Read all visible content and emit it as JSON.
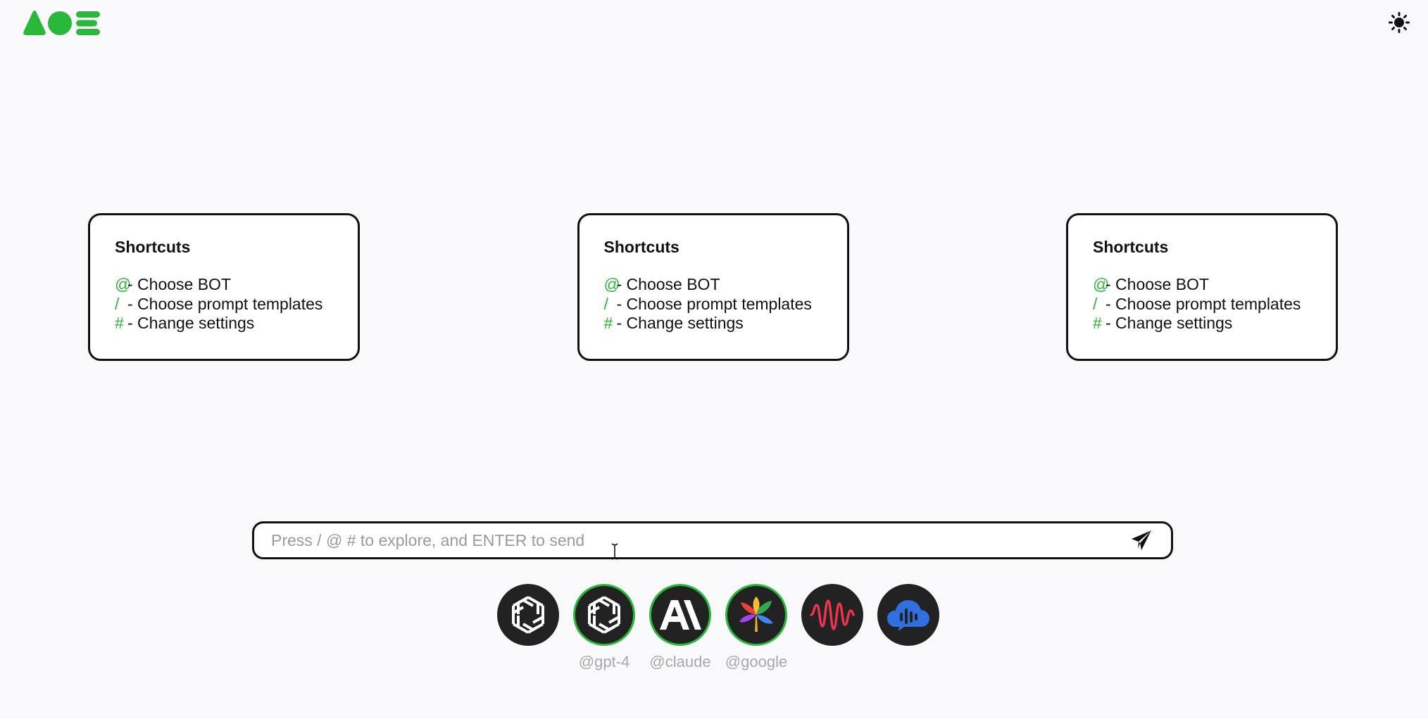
{
  "brand": {
    "logo_icon": "aoe-logo-icon",
    "accent": "#2ab83a"
  },
  "header": {
    "theme_icon": "sun-icon"
  },
  "cards": [
    {
      "title": "Shortcuts",
      "lines": [
        {
          "key": "@",
          "text": "- Choose BOT"
        },
        {
          "key": "/",
          "text": "- Choose prompt templates"
        },
        {
          "key": "#",
          "text": "- Change settings"
        }
      ]
    },
    {
      "title": "Shortcuts",
      "lines": [
        {
          "key": "@",
          "text": "- Choose BOT"
        },
        {
          "key": "/",
          "text": "- Choose prompt templates"
        },
        {
          "key": "#",
          "text": "- Change settings"
        }
      ]
    },
    {
      "title": "Shortcuts",
      "lines": [
        {
          "key": "@",
          "text": "- Choose BOT"
        },
        {
          "key": "/",
          "text": "- Choose prompt templates"
        },
        {
          "key": "#",
          "text": "- Change settings"
        }
      ]
    }
  ],
  "composer": {
    "placeholder": "Press / @ # to explore, and ENTER to send",
    "value": "",
    "send_icon": "send-icon"
  },
  "bots": [
    {
      "icon": "openai-icon",
      "label": "",
      "selected": false
    },
    {
      "icon": "openai-icon",
      "label": "@gpt-4",
      "selected": true
    },
    {
      "icon": "anthropic-icon",
      "label": "@claude",
      "selected": true
    },
    {
      "icon": "google-bard-icon",
      "label": "@google",
      "selected": true
    },
    {
      "icon": "soundwave-icon",
      "label": "",
      "selected": false
    },
    {
      "icon": "cloud-voice-icon",
      "label": "",
      "selected": false
    }
  ]
}
